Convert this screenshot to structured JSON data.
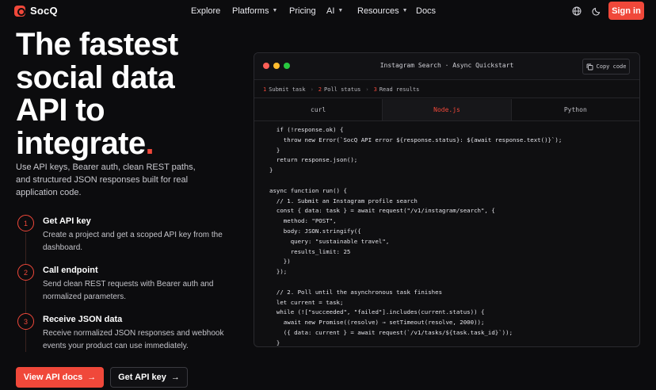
{
  "brand": {
    "name": "SocQ"
  },
  "nav": {
    "links": [
      {
        "label": "Explore",
        "dropdown": false
      },
      {
        "label": "Platforms",
        "dropdown": true
      },
      {
        "label": "Pricing",
        "dropdown": false
      },
      {
        "label": "AI",
        "dropdown": true
      },
      {
        "label": "Resources",
        "dropdown": true
      },
      {
        "label": "Docs",
        "dropdown": false
      }
    ],
    "signin_label": "Sign in"
  },
  "hero": {
    "title_lines": [
      "The fastest",
      "social data",
      "API to",
      "integrate"
    ],
    "title_dot": ".",
    "description": "Use API keys, Bearer auth, clean REST paths, and structured JSON responses built for real application code."
  },
  "steps": [
    {
      "num": "1",
      "title": "Get API key",
      "desc": "Create a project and get a scoped API key from the dashboard."
    },
    {
      "num": "2",
      "title": "Call endpoint",
      "desc": "Send clean REST requests with Bearer auth and normalized parameters."
    },
    {
      "num": "3",
      "title": "Receive JSON data",
      "desc": "Receive normalized JSON responses and webhook events your product can use immediately."
    }
  ],
  "cta": {
    "primary_label": "View API docs",
    "secondary_label": "Get API key",
    "arrow": "→"
  },
  "panel": {
    "title": "Instagram Search · Async Quickstart",
    "copy_label": "Copy code",
    "flow": [
      {
        "num": "1",
        "label": "Submit task"
      },
      {
        "num": "2",
        "label": "Poll status"
      },
      {
        "num": "3",
        "label": "Read results"
      }
    ],
    "tabs": [
      "curl",
      "Node.js",
      "Python"
    ],
    "active_tab": "Node.js",
    "code": "  if (!response.ok) {\n    throw new Error(`SocQ API error ${response.status}: ${await response.text()}`);\n  }\n  return response.json();\n}\n\nasync function run() {\n  // 1. Submit an Instagram profile search\n  const { data: task } = await request(\"/v1/instagram/search\", {\n    method: \"POST\",\n    body: JSON.stringify({\n      query: \"sustainable travel\",\n      results_limit: 25\n    })\n  });\n\n  // 2. Poll until the asynchronous task finishes\n  let current = task;\n  while (![\"succeeded\", \"failed\"].includes(current.status)) {\n    await new Promise((resolve) ⇒ setTimeout(resolve, 2000));\n    ({ data: current } = await request(`/v1/tasks/${task.task_id}`));\n  }"
  },
  "colors": {
    "accent": "#f0483a",
    "background": "#0c0c0e",
    "dot_red": "#ff5f57",
    "dot_yellow": "#febc2e",
    "dot_green": "#28c840"
  },
  "icons": {
    "theme_globe": "globe-icon",
    "theme_moon": "moon-icon"
  }
}
